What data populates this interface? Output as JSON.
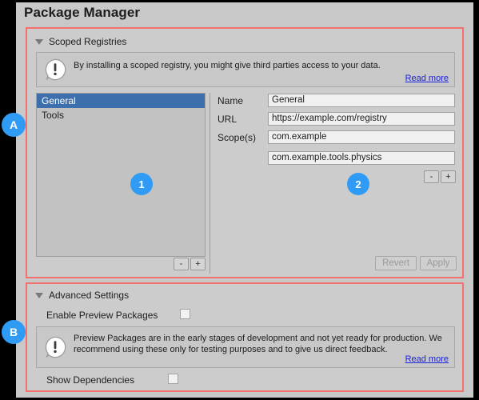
{
  "window": {
    "title": "Package Manager"
  },
  "scoped_registries": {
    "header_label": "Scoped Registries",
    "disclosure_icon": "triangle-down-icon",
    "warning": {
      "icon": "exclamation-bubble-icon",
      "text": "By installing a scoped registry, you might give third parties access to your data.",
      "link_label": "Read more"
    },
    "registry_list": {
      "items": [
        {
          "label": "General",
          "selected": true
        },
        {
          "label": "Tools",
          "selected": false
        }
      ],
      "remove_label": "-",
      "add_label": "+"
    },
    "details": {
      "name_label": "Name",
      "name_value": "General",
      "url_label": "URL",
      "url_value": "https://example.com/registry",
      "scopes_label": "Scope(s)",
      "scopes_values": [
        "com.example",
        "com.example.tools.physics"
      ],
      "scope_remove_label": "-",
      "scope_add_label": "+"
    },
    "revert_label": "Revert",
    "apply_label": "Apply"
  },
  "advanced_settings": {
    "header_label": "Advanced Settings",
    "disclosure_icon": "triangle-down-icon",
    "enable_preview_label": "Enable Preview Packages",
    "enable_preview_checked": false,
    "warning": {
      "icon": "exclamation-bubble-icon",
      "line1": "Preview Packages are in the early stages of development and not yet ready for production. We",
      "line2": "recommend using these only for testing purposes and to give us direct feedback.",
      "link_label": "Read more"
    },
    "show_dependencies_label": "Show Dependencies",
    "show_dependencies_checked": false
  },
  "annotations": {
    "section_a": "A",
    "section_b": "B",
    "callout_1": "1",
    "callout_2": "2"
  },
  "colors": {
    "highlight_border": "#f4706c",
    "badge": "#2f9bf4",
    "selection": "#3e6fad",
    "link": "#1a22e0",
    "panel": "#c8c8c8"
  }
}
